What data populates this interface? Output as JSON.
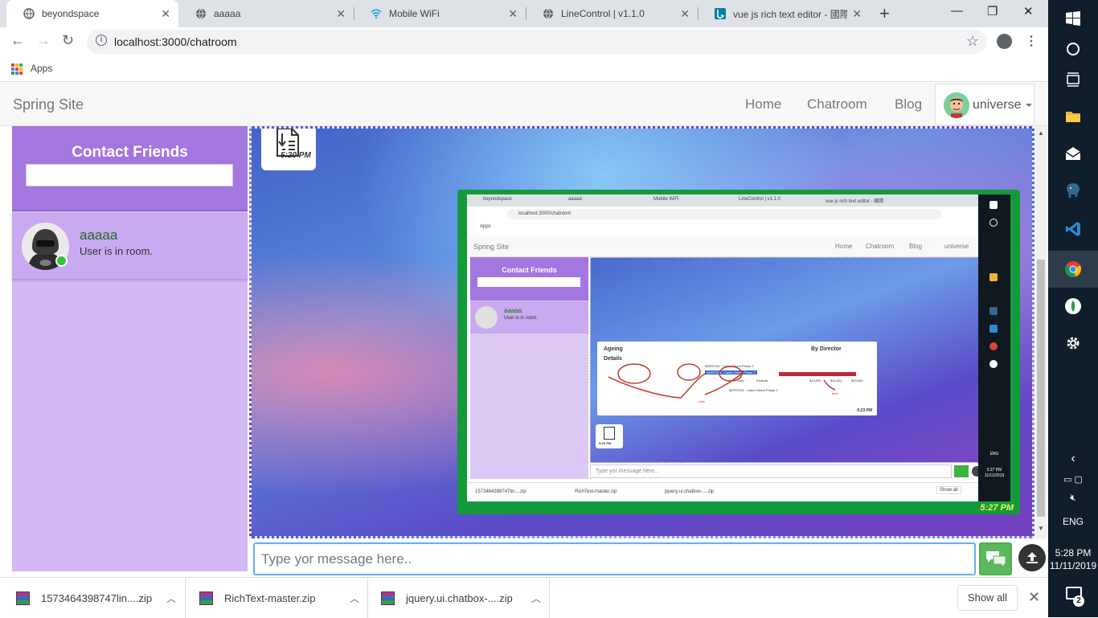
{
  "browser": {
    "tabs": [
      {
        "title": "beyondspace",
        "icon": "globe-icon",
        "active": true
      },
      {
        "title": "aaaaa",
        "icon": "globe-icon",
        "active": false
      },
      {
        "title": "Mobile WiFi",
        "icon": "wifi-icon",
        "active": false
      },
      {
        "title": "LineControl | v1.1.0",
        "icon": "globe-icon",
        "active": false
      },
      {
        "title": "vue js rich text editor - 國際",
        "icon": "bing-icon",
        "active": false
      }
    ],
    "url": "localhost:3000/chatroom",
    "bookmarks_apps_label": "Apps"
  },
  "navbar": {
    "brand": "Spring Site",
    "links": [
      "Home",
      "Chatroom",
      "Blog"
    ],
    "user": "universe"
  },
  "sidebar": {
    "title": "Contact Friends",
    "search_value": "",
    "contacts": [
      {
        "name": "aaaaa",
        "status": "User is in room.",
        "online": true
      }
    ]
  },
  "chat": {
    "messages": [
      {
        "type": "file",
        "time": "5:20 PM"
      },
      {
        "type": "image",
        "time": "5:27 PM"
      }
    ],
    "input_placeholder": "Type yor message here..",
    "input_value": ""
  },
  "embedded_screenshot": {
    "tabs": [
      "beyondspace",
      "aaaaa",
      "Mobile WiFi",
      "LineControl | v1.1.0",
      "vue js rich text editor - 國際"
    ],
    "url": "localhost:3000/chatroom",
    "apps": "Apps",
    "brand": "Spring Site",
    "links": [
      "Home",
      "Chatroom",
      "Blog",
      "universe"
    ],
    "sidebar_title": "Contact Friends",
    "contact_name": "aaaaa",
    "contact_status": "User is in room.",
    "report": {
      "title": "Ageing",
      "subtitle": "Details",
      "right_title": "By Director",
      "row1": "MERITON - Carter Street Phase 2",
      "row2": "MERITON - Carter Street Phase 2",
      "btn1": "Only",
      "btn2": "Exclude",
      "popup": "MERITON - Carter Street Phase 2",
      "ticks": [
        "$10,000",
        "$15,000",
        "$20,000"
      ],
      "click": "click",
      "then": "then",
      "time": "5:23 PM"
    },
    "file_time": "5:20 PM",
    "input_placeholder": "Type yor message here...",
    "downloads": [
      "1573464398747lin....zip",
      "RichText-master.zip",
      "jquery.ui.chatbox-....zip"
    ],
    "show_all": "Show all",
    "taskbar": {
      "lang": "ENG",
      "time": "5:27 PM",
      "date": "11/11/2019"
    }
  },
  "downloads": {
    "items": [
      "1573464398747lin....zip",
      "RichText-master.zip",
      "jquery.ui.chatbox-....zip"
    ],
    "show_all": "Show all"
  },
  "taskbar": {
    "lang": "ENG",
    "time": "5:28 PM",
    "date": "11/11/2019",
    "notifications": "2"
  },
  "colors": {
    "sidebar_header": "#a376e0",
    "sidebar_bg": "#d2b9f1",
    "contact_card": "#c9a9f0",
    "contact_name": "#1a6d20",
    "send_button": "#5cb85c",
    "image_frame": "#139b3b",
    "taskbar": "#101d2a"
  }
}
